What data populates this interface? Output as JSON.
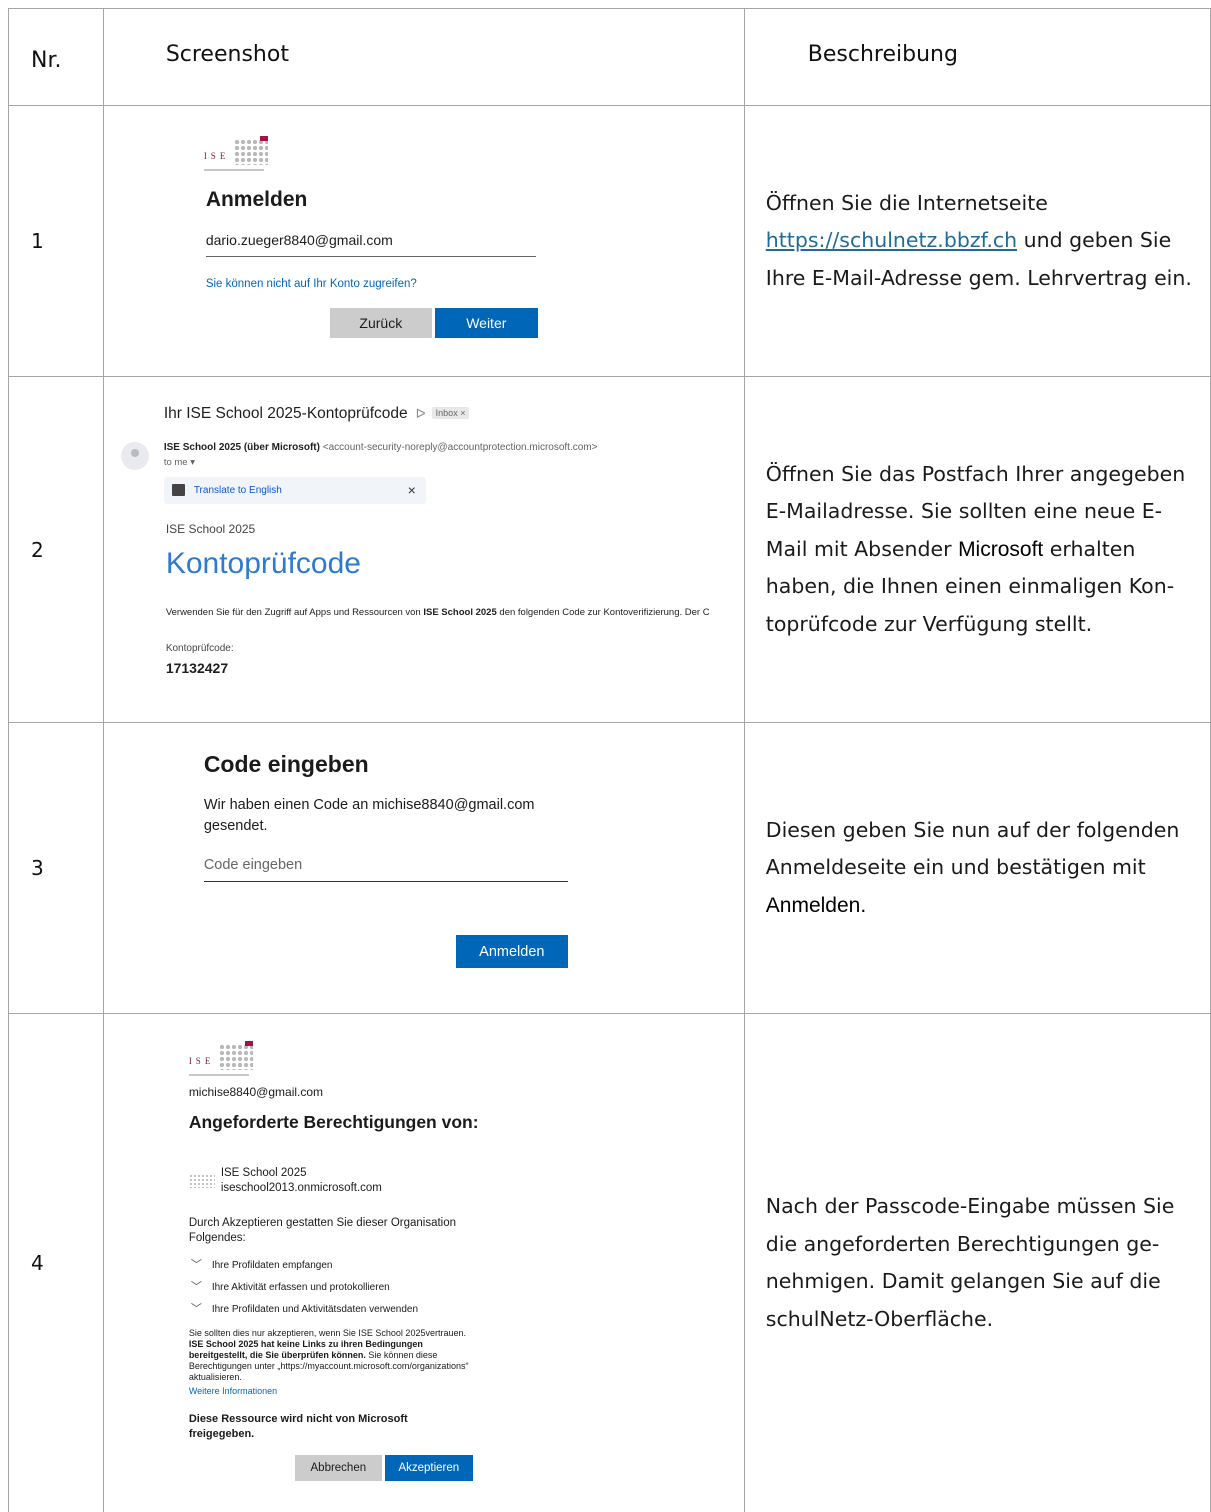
{
  "header": {
    "nr": "Nr.",
    "screenshot": "Screenshot",
    "description": "Beschreibung"
  },
  "rows": [
    {
      "nr": "1",
      "shot": {
        "title": "Anmelden",
        "email": "dario.zueger8840@gmail.com",
        "link": "Sie können nicht auf Ihr Konto zugreifen?",
        "back_label": "Zurück",
        "next_label": "Weiter"
      },
      "desc": {
        "pre": "Öffnen Sie die Internetseite ",
        "link": "https://schulnetz.bbzf.ch",
        "post": " und geben Sie Ihre E-Mail-Adresse gem. Lehrvertrag ein."
      }
    },
    {
      "nr": "2",
      "shot": {
        "subject": "Ihr ISE School 2025-Kontoprüfcode",
        "inbox_label": "Inbox ×",
        "sender_name": "ISE School 2025 (über Microsoft)",
        "sender_addr": "<account-security-noreply@accountprotection.microsoft.com>",
        "to_me": "to me ▾",
        "translate": "Translate to English",
        "org": "ISE School 2025",
        "big_title": "Kontoprüfcode",
        "use_pre": "Verwenden Sie für den Zugriff auf Apps und Ressourcen von ",
        "use_bold": "ISE School 2025",
        "use_post": " den folgenden Code zur Kontoverifizierung. Der C",
        "code_label": "Kontoprüfcode:",
        "code": "17132427"
      },
      "desc": {
        "pre": "Öffnen Sie das Postfach Ihrer angegeben E-Mailadresse. Sie sollten eine neue E-Mail mit Absender ",
        "bold": "Microsoft",
        "post": " erhalten haben, die Ihnen einen einmaligen Kon-toprüfcode zur Verfügung stellt."
      }
    },
    {
      "nr": "3",
      "shot": {
        "title": "Code eingeben",
        "message": "Wir haben einen Code an michise8840@gmail.com gesendet.",
        "input_placeholder": "Code eingeben",
        "signin_label": "Anmelden"
      },
      "desc": {
        "pre": "Diesen geben Sie nun auf der folgenden Anmeldeseite ein und bestätigen mit ",
        "bold": "Anmelden."
      }
    },
    {
      "nr": "4",
      "shot": {
        "email": "michise8840@gmail.com",
        "title": "Angeforderte Berechtigungen von:",
        "app_name": "ISE School 2025",
        "app_domain": "iseschool2013.onmicrosoft.com",
        "intro": "Durch Akzeptieren gestatten Sie dieser Organisation Folgendes:",
        "permissions": [
          "Ihre Profildaten empfangen",
          "Ihre Aktivität erfassen und protokollieren",
          "Ihre Profildaten und Aktivitätsdaten verwenden"
        ],
        "note_pre": "Sie sollten dies nur akzeptieren, wenn Sie ISE School 2025vertrauen. ",
        "note_bold": "ISE School 2025 hat keine Links zu ihren Bedingungen bereitgestellt, die Sie überprüfen können.",
        "note_post": " Sie können diese Berechtigungen unter „https://myaccount.microsoft.com/organizations“ aktualisieren.",
        "more": "Weitere Informationen",
        "warning": "Diese Ressource wird nicht von Microsoft freigegeben.",
        "cancel_label": "Abbrechen",
        "accept_label": "Akzeptieren"
      },
      "desc": {
        "text": "Nach der Passcode-Eingabe müssen Sie die angeforderten Berechtigungen ge-nehmigen. Damit gelangen Sie auf die schulNetz-Oberfläche."
      }
    }
  ],
  "colors": {
    "accent_blue": "#0067b8",
    "link_teal": "#1f6b9a",
    "logo_red": "#a0144a"
  }
}
